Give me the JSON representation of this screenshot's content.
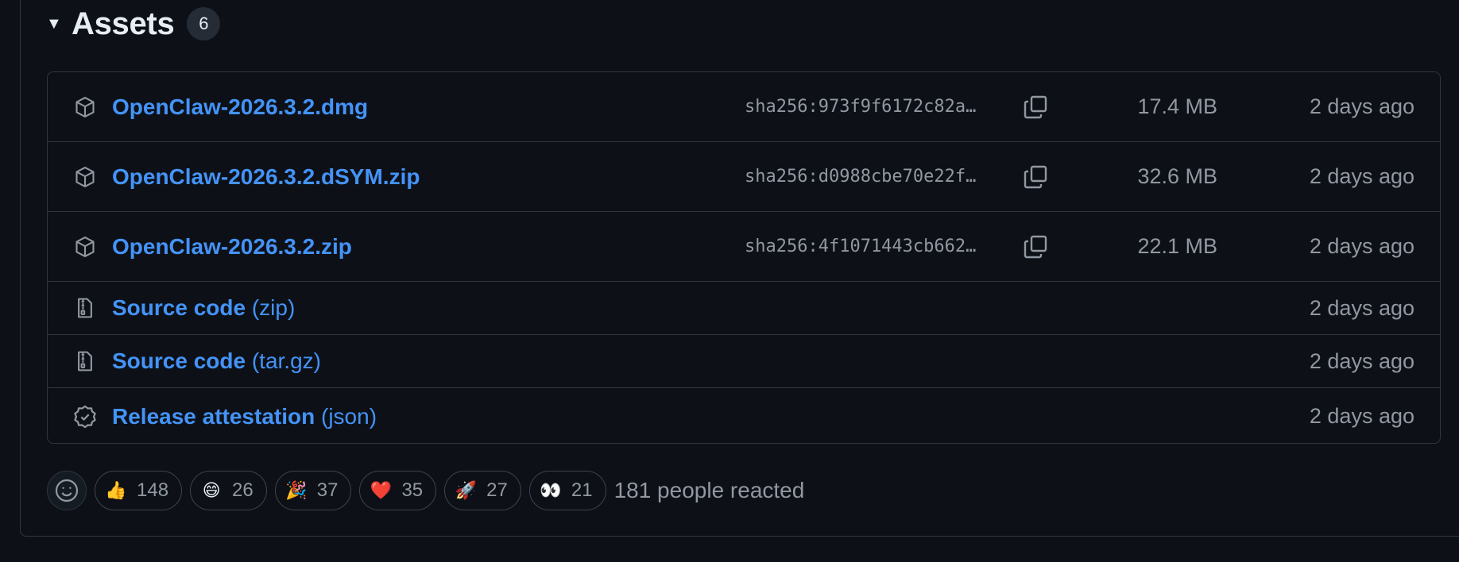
{
  "assets": {
    "caret": "▼",
    "title": "Assets",
    "count": "6",
    "rows": [
      {
        "icon": "package-icon",
        "name": "OpenClaw-2026.3.2.dmg",
        "sha": "sha256:973f9f6172c82a…",
        "size": "17.4 MB",
        "time": "2 days ago"
      },
      {
        "icon": "package-icon",
        "name": "OpenClaw-2026.3.2.dSYM.zip",
        "sha": "sha256:d0988cbe70e22f…",
        "size": "32.6 MB",
        "time": "2 days ago"
      },
      {
        "icon": "package-icon",
        "name": "OpenClaw-2026.3.2.zip",
        "sha": "sha256:4f1071443cb662…",
        "size": "22.1 MB",
        "time": "2 days ago"
      },
      {
        "icon": "file-zip-icon",
        "name": "Source code",
        "ext": "(zip)",
        "time": "2 days ago"
      },
      {
        "icon": "file-zip-icon",
        "name": "Source code",
        "ext": "(tar.gz)",
        "time": "2 days ago"
      },
      {
        "icon": "verified-icon",
        "name": "Release attestation",
        "ext": "(json)",
        "time": "2 days ago"
      }
    ]
  },
  "reactions": {
    "items": [
      {
        "name": "thumbs-up",
        "emoji": "👍",
        "count": "148"
      },
      {
        "name": "laugh",
        "emoji": "😄",
        "count": "26"
      },
      {
        "name": "hooray",
        "emoji": "🎉",
        "count": "37"
      },
      {
        "name": "heart",
        "emoji": "❤️",
        "count": "35"
      },
      {
        "name": "rocket",
        "emoji": "🚀",
        "count": "27"
      },
      {
        "name": "eyes",
        "emoji": "👀",
        "count": "21"
      }
    ],
    "summary": "181 people reacted"
  },
  "colors": {
    "background": "#0d1117",
    "border": "#30363d",
    "link": "#4493f8",
    "muted": "#9198a1",
    "text": "#e6edf3"
  }
}
